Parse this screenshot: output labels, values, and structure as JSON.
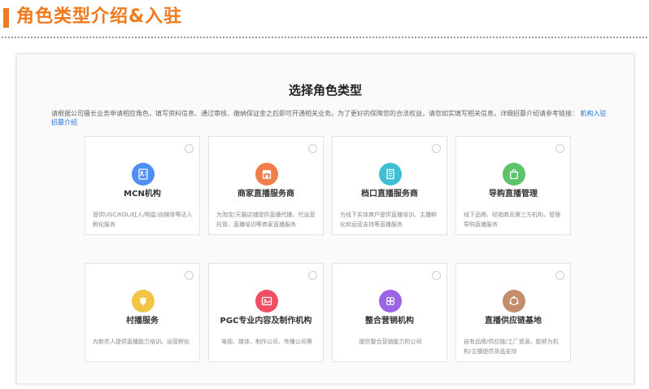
{
  "header": {
    "title": "角色类型介绍&入驻"
  },
  "panel": {
    "title": "选择角色类型",
    "intro_text": "请根据公司擅长业务申请相应角色，填写资料信息、通过审核、缴纳保证金之后即可开通相关业务。为了更好的保障您的合法权益，请您如实填写相关信息。详细招募介绍请参考链接：",
    "intro_link": "机构入驻招募介绍"
  },
  "roles": [
    {
      "title": "MCN机构",
      "desc": "提供UGC/KOL/红人/明星/自媒体等达人孵化服务",
      "icon": "person-card-icon",
      "color": "#4f8ef2"
    },
    {
      "title": "商家直播服务商",
      "desc": "为淘宝/天猫店铺提供直播代播、代运营托管、直播培训等商家直播服务",
      "icon": "store-icon",
      "color": "#f07e4b"
    },
    {
      "title": "档口直播服务商",
      "desc": "为线下实体商户提供直播培训、主播孵化和运营支持等直播服务",
      "icon": "building-icon",
      "color": "#3fbfd3"
    },
    {
      "title": "导购直播管理",
      "desc": "线下品牌、经销商及第三方机构，管理导购直播服务",
      "icon": "shopping-bag-icon",
      "color": "#5cc36a"
    },
    {
      "title": "村播服务",
      "desc": "为新农人提供直播能力培训、运营孵化",
      "icon": "wheat-icon",
      "color": "#f3c545"
    },
    {
      "title": "PGC专业内容及制作机构",
      "desc": "电视、媒体、制作公司、传播公司等",
      "icon": "media-icon",
      "color": "#ef4f64"
    },
    {
      "title": "整合营销机构",
      "desc": "提供整合营销能力的公司",
      "icon": "clover-icon",
      "color": "#9b63e6"
    },
    {
      "title": "直播供应链基地",
      "desc": "自有品牌/供应链/工厂资源，能够为机构/主播提供货品支持",
      "icon": "supply-chain-icon",
      "color": "#c48d6d"
    }
  ]
}
